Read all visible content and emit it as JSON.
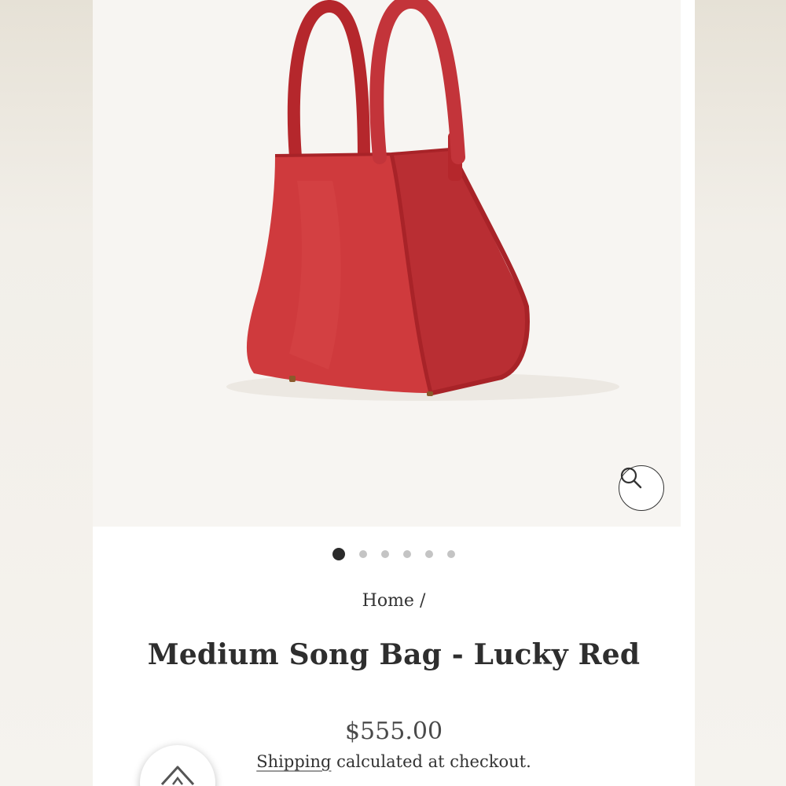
{
  "product": {
    "title": "Medium Song Bag - Lucky Red",
    "price": "$555.00",
    "shipping_link": "Shipping",
    "shipping_rest": " calculated at checkout.",
    "color": "#c8373a"
  },
  "breadcrumb": {
    "home": "Home /"
  },
  "gallery": {
    "slide_count": 6,
    "active_slide": 1,
    "zoom_icon": "search-icon"
  },
  "floating": {
    "icon": "house-icon"
  }
}
